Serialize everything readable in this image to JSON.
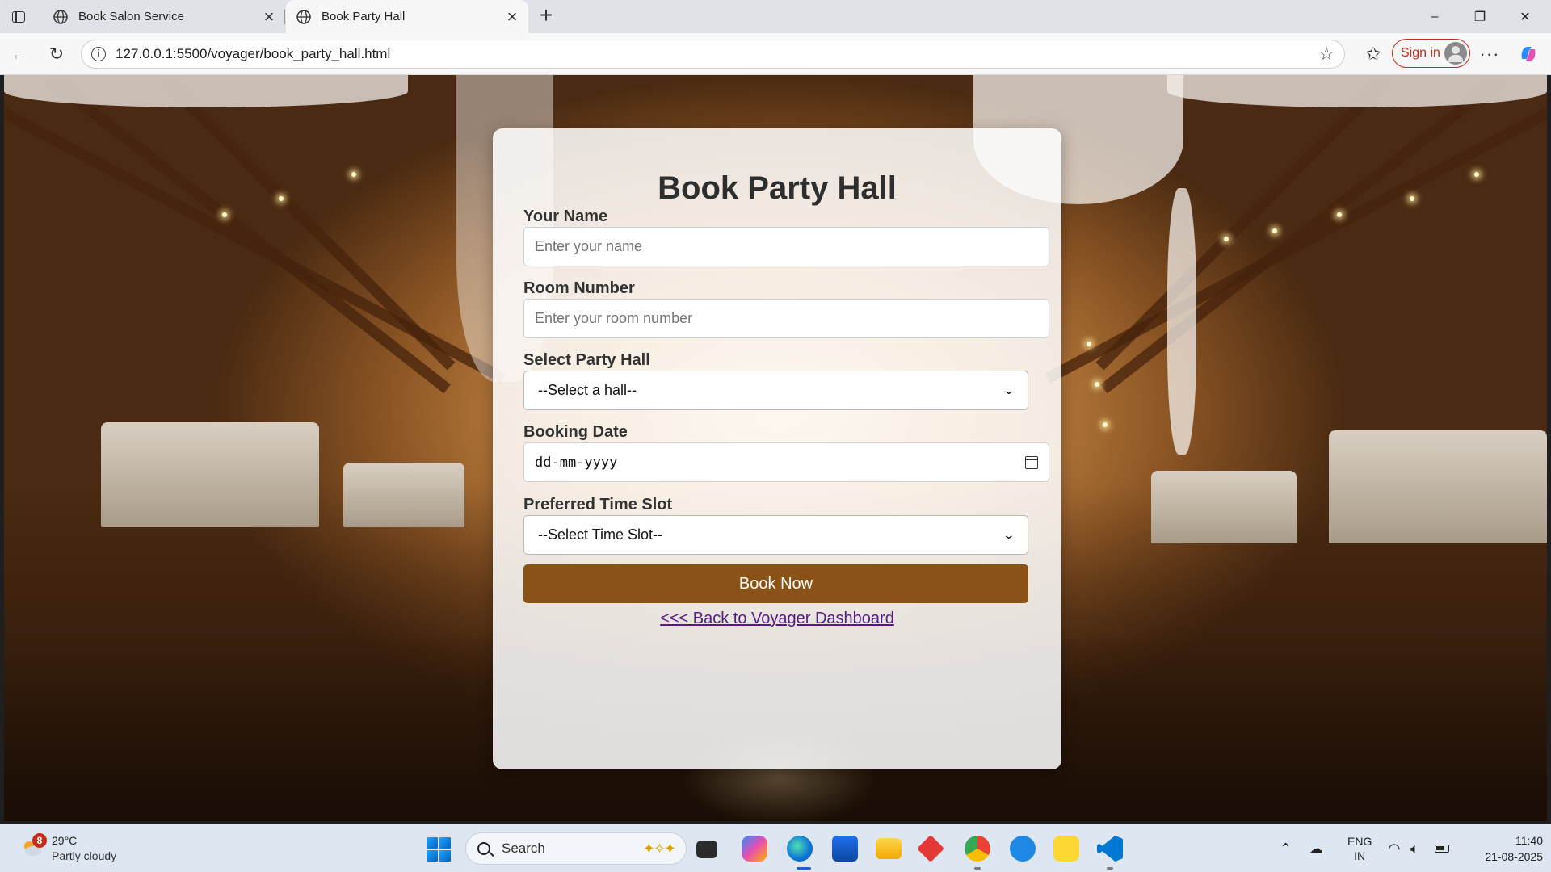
{
  "browser": {
    "tabs": [
      {
        "title": "Book Salon Service",
        "active": false
      },
      {
        "title": "Book Party Hall",
        "active": true
      }
    ],
    "url": "127.0.0.1:5500/voyager/book_party_hall.html",
    "sign_in_label": "Sign in",
    "window_controls": {
      "minimize": "–",
      "maximize": "❐",
      "close": "✕"
    },
    "new_tab_glyph": "+"
  },
  "form": {
    "heading": "Book Party Hall",
    "name": {
      "label": "Your Name",
      "placeholder": "Enter your name"
    },
    "room": {
      "label": "Room Number",
      "placeholder": "Enter your room number"
    },
    "hall": {
      "label": "Select Party Hall",
      "selected": "--Select a hall--"
    },
    "date": {
      "label": "Booking Date",
      "value": "dd-mm-yyyy"
    },
    "time_slot": {
      "label": "Preferred Time Slot",
      "selected": "--Select Time Slot--"
    },
    "submit_label": "Book Now",
    "back_link": "<<< Back to Voyager Dashboard",
    "colors": {
      "button": "#8b5217",
      "link": "#551a8b"
    }
  },
  "taskbar": {
    "weather": {
      "badge": "8",
      "temp": "29°C",
      "condition": "Partly cloudy"
    },
    "search_label": "Search",
    "language": {
      "line1": "ENG",
      "line2": "IN"
    },
    "time": "11:40",
    "date": "21-08-2025",
    "pinned_icons": [
      "task-view-icon",
      "copilot-icon",
      "edge-icon",
      "store-icon",
      "file-explorer-icon",
      "app-red-icon",
      "chrome-icon",
      "app-blue-icon",
      "app-yellow-p-icon",
      "vscode-icon"
    ]
  }
}
